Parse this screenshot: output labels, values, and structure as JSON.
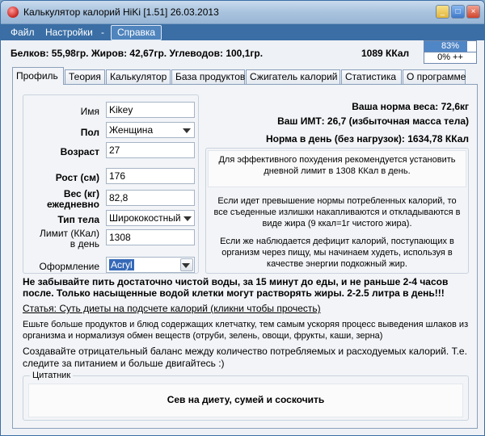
{
  "window": {
    "title": "Калькулятор калорий HiKi [1.51] 26.03.2013",
    "controls": {
      "minimize": "_",
      "maximize": "□",
      "close": "×"
    }
  },
  "menu": {
    "file": "Файл",
    "settings": "Настройки",
    "separator": "-",
    "help": "Справка"
  },
  "summary": {
    "nutrients": "Белков: 55,98гр. Жиров: 42,67гр. Углеводов: 100,1гр.",
    "kcal": "1089 ККал",
    "progress_label": "83%",
    "progress_value": 0.83,
    "delta_label": "0% ++"
  },
  "tabs": [
    "Профиль",
    "Теория",
    "Калькулятор",
    "База продуктов",
    "Сжигатель калорий",
    "Статистика",
    "О программе"
  ],
  "profile": {
    "name_label": "Имя",
    "name_value": "Kikey",
    "sex_label": "Пол",
    "sex_value": "Женщина",
    "age_label": "Возраст",
    "age_value": "27",
    "height_label": "Рост (см)",
    "height_value": "176",
    "weight_label_1": "Вес (кг)",
    "weight_label_2": "ежедневно",
    "weight_value": "82,8",
    "body_label": "Тип тела",
    "body_value": "Ширококостный",
    "limit_label_1": "Лимит (ККал)",
    "limit_label_2": "в день",
    "limit_value": "1308",
    "theme_label": "Оформление",
    "theme_value": "Acryl"
  },
  "stats": {
    "norm_weight": "Ваша норма веса: 72,6кг",
    "bmi": "Ваш ИМТ: 26,7 (избыточная масса тела)",
    "daily_norm": "Норма в день (без нагрузок): 1634,78 ККал"
  },
  "advice": {
    "p1": "Для эффективного похудения рекомендуется установить дневной лимит в 1308 ККал в день.",
    "p2": "Если идет превышение нормы потребленных калорий, то все съеденные излишки накапливаются и откладываются в виде жира (9 ккал=1г чистого жира).",
    "p3": "Если же наблюдается дефицит калорий, поступающих в организм через пищу, мы начинаем худеть, используя в качестве энергии подкожный жир."
  },
  "water_tip": "Не забывайте пить достаточно чистой воды, за 15 минут до еды, и не раньше 2-4 часов после. Только насыщенные водой клетки могут растворять жиры. 2-2.5 литра в день!!!",
  "article_link": "Статья: Суть диеты на подсчете калорий (кликни чтобы прочесть)",
  "tip_fiber": "Ешьте больше продуктов и блюд содержащих клетчатку, тем самым ускоряя процесс выведения шлаков из организма и нормализуя обмен веществ (отруби, зелень, овощи, фрукты, каши, зерна)",
  "tip_balance": "Создавайте отрицательный баланс между количество потребляемых и расходуемых калорий. Т.е. следите за питанием и больше двигайтесь :)",
  "quote": {
    "legend": "Цитатник",
    "text": "Сев на диету, сумей и соскочить"
  }
}
